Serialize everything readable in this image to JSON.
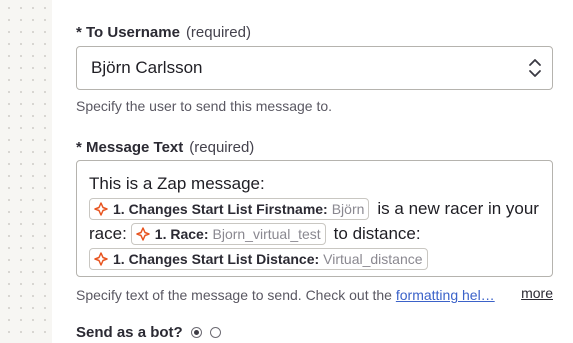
{
  "to_username": {
    "label": "* To Username",
    "required": "(required)",
    "value": "Björn Carlsson",
    "help": "Specify the user to send this message to."
  },
  "message_text": {
    "label": "* Message Text",
    "required": "(required)",
    "text_1": "This is a Zap message:",
    "pill_1": {
      "key": "1. Changes Start List Firstname:",
      "value": "Björn"
    },
    "text_2": "is a new racer in your",
    "text_3": "race:",
    "pill_2": {
      "key": "1. Race:",
      "value": "Bjorn_virtual_test"
    },
    "text_4": "to distance:",
    "pill_3": {
      "key": "1. Changes Start List Distance:",
      "value": "Virtual_distance"
    },
    "help_prefix": "Specify text of the message to send. Check out the",
    "help_link": "formatting hel…",
    "more": "more"
  },
  "send_as_bot": {
    "label": "Send as a bot?",
    "selected": "first"
  },
  "colors": {
    "accent": "#e8541f",
    "link": "#3b62c9"
  },
  "icons": {
    "step": "zapier-step-icon",
    "select": "chevron-up-down-icon"
  }
}
